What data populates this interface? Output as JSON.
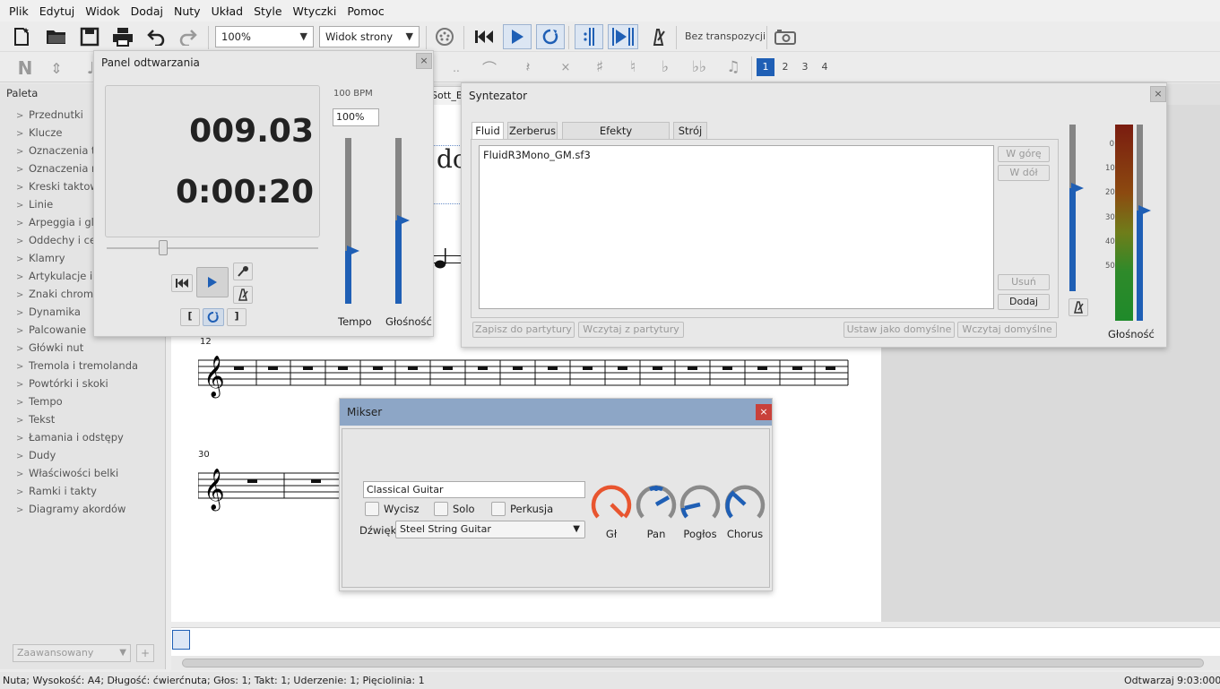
{
  "menu": [
    "Plik",
    "Edytuj",
    "Widok",
    "Dodaj",
    "Nuty",
    "Układ",
    "Style",
    "Wtyczki",
    "Pomoc"
  ],
  "toolbar": {
    "zoom": "100%",
    "view_mode": "Widok strony",
    "transpose": "Bez transpozycji",
    "voices": [
      "1",
      "2",
      "3",
      "4"
    ]
  },
  "palette": {
    "header": "Paleta",
    "items": [
      "Przednutki",
      "Klucze",
      "Oznaczenia tonacji",
      "Oznaczenia metrum",
      "Kreski taktowe",
      "Linie",
      "Arpeggia i glissanda",
      "Oddechy i cezury",
      "Klamry",
      "Artykulacje i ozdobniki",
      "Znaki chromatyczne",
      "Dynamika",
      "Palcowanie",
      "Główki nut",
      "Tremola i tremolanda",
      "Powtórki i skoki",
      "Tempo",
      "Tekst",
      "Łamania i odstępy",
      "Dudy",
      "Właściwości belki",
      "Ramki i takty",
      "Diagramy akordów"
    ],
    "workspace": "Zaawansowany",
    "add_label": "+"
  },
  "score": {
    "tab_fragment": "Sott_B",
    "title_fragment": "do",
    "measure_12": "12",
    "measure_30": "30"
  },
  "playback_panel": {
    "title": "Panel odtwarzania",
    "measure_beat": "009.03",
    "time": "0:00:20",
    "bpm": "100 BPM",
    "tempo_pct": "100%",
    "tempo_label": "Tempo",
    "volume_label": "Głośność",
    "loop_in": "[",
    "loop_out": "]",
    "tempo_level": 0.32,
    "volume_level": 0.5
  },
  "synth": {
    "title": "Syntezator",
    "tabs": [
      "Fluid",
      "Zerberus",
      "Efekty zaawansowane",
      "Strój"
    ],
    "soundfonts": [
      "FluidR3Mono_GM.sf3"
    ],
    "btn_up": "W górę",
    "btn_down": "W dół",
    "btn_remove": "Usuń",
    "btn_add": "Dodaj",
    "btn_save": "Zapisz do partytury",
    "btn_load": "Wczytaj z partytury",
    "btn_setdefault": "Ustaw jako domyślne",
    "btn_loaddefault": "Wczytaj domyślne",
    "meter_ticks": [
      "0",
      "10",
      "20",
      "30",
      "40",
      "50"
    ],
    "volume_label": "Głośność",
    "volume_level": 0.56
  },
  "mixer": {
    "title": "Mikser",
    "part_name": "Classical Guitar",
    "mute": "Wycisz",
    "solo": "Solo",
    "drum": "Perkusja",
    "sound_label": "Dźwięk:",
    "sound": "Steel String Guitar",
    "knobs": [
      "Gł",
      "Pan",
      "Pogłos",
      "Chorus"
    ]
  },
  "statusbar": {
    "text": "Nuta; Wysokość: A4; Długość: ćwierćnuta; Głos: 1;  Takt: 1; Uderzenie: 1; Pięciolinia: 1",
    "mode": "Odtwarzaj",
    "time": "9:03:000"
  },
  "colors": {
    "accent": "#1f5fb5",
    "knob_red": "#e8552f",
    "mixer_title": "#8da6c6"
  }
}
